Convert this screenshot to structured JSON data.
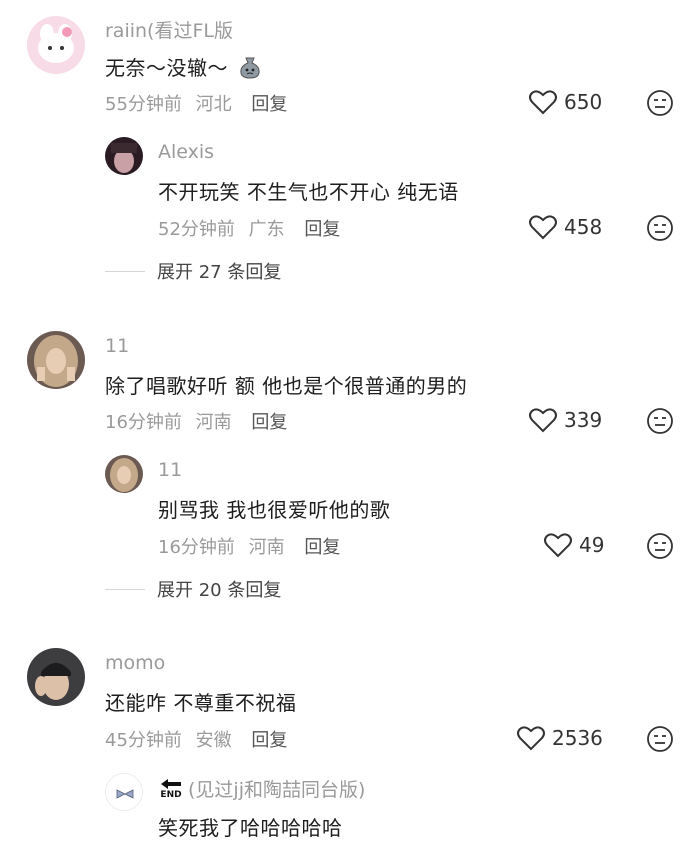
{
  "comments": [
    {
      "user": "raiin(看过FL版",
      "text": "无奈～没辙～",
      "time": "55分钟前",
      "location": "河北",
      "reply_label": "回复",
      "likes": "650",
      "replies": [
        {
          "user": "Alexis",
          "text": "不开玩笑 不生气也不开心 纯无语",
          "time": "52分钟前",
          "location": "广东",
          "reply_label": "回复",
          "likes": "458"
        }
      ],
      "expand": "展开 27 条回复"
    },
    {
      "user": "11",
      "text": "除了唱歌好听 额 他也是个很普通的男的",
      "time": "16分钟前",
      "location": "河南",
      "reply_label": "回复",
      "likes": "339",
      "replies": [
        {
          "user": "11",
          "text": "别骂我 我也很爱听他的歌",
          "time": "16分钟前",
          "location": "河南",
          "reply_label": "回复",
          "likes": "49"
        }
      ],
      "expand": "展开 20 条回复"
    },
    {
      "user": "momo",
      "text": "还能咋 不尊重不祝福",
      "time": "45分钟前",
      "location": "安徽",
      "reply_label": "回复",
      "likes": "2536",
      "replies": [
        {
          "user": "(见过jj和陶喆同台版)",
          "badge": "END",
          "text": "笑死我了哈哈哈哈哈"
        }
      ]
    }
  ],
  "colors": {
    "username": "#9a9a9a",
    "text": "#1e1e1e",
    "meta": "#9a9a9a"
  }
}
